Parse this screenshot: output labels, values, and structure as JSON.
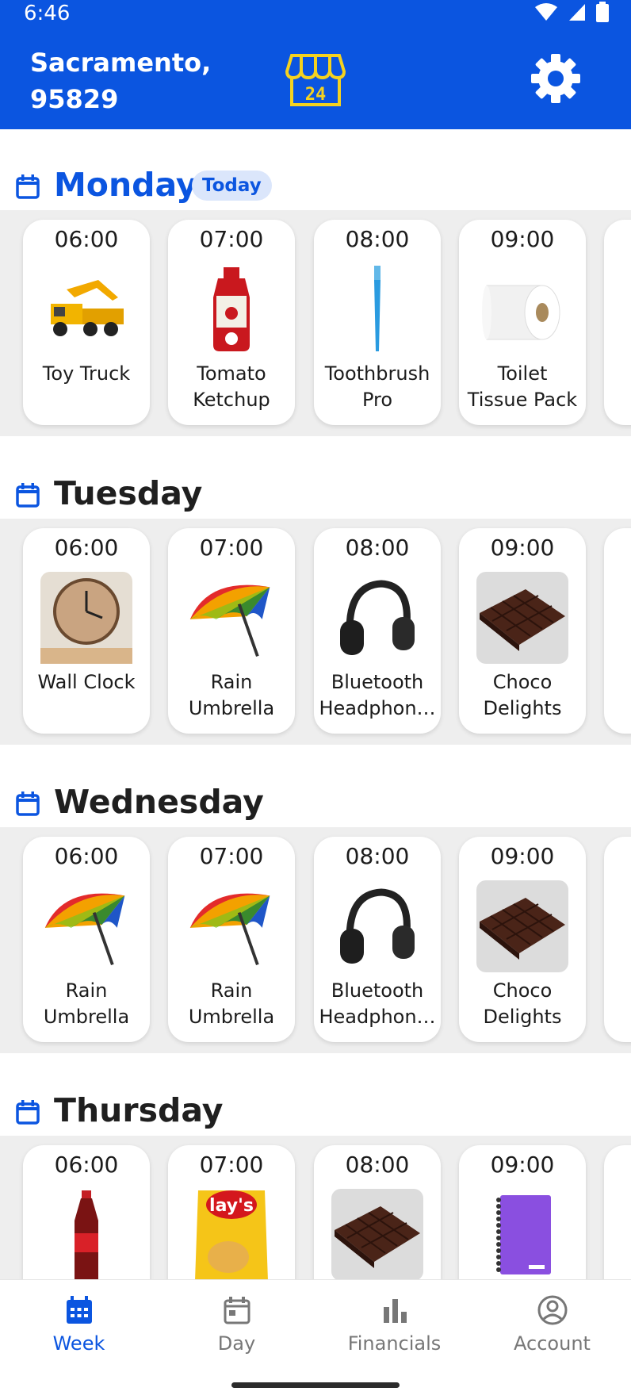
{
  "status": {
    "time": "6:46"
  },
  "header": {
    "location_line1": "Sacramento,",
    "location_line2": "95829",
    "store_icon": "store-24-icon",
    "settings_icon": "gear-icon",
    "brand_color": "#0b55e0",
    "accent_color": "#f5d21f"
  },
  "days": [
    {
      "name": "Monday",
      "badge": "Today",
      "items": [
        {
          "time": "06:00",
          "line1": "Toy Truck",
          "line2": "",
          "icon": "toy-truck-icon"
        },
        {
          "time": "07:00",
          "line1": "Tomato",
          "line2": "Ketchup",
          "icon": "ketchup-bottle-icon"
        },
        {
          "time": "08:00",
          "line1": "Toothbrush",
          "line2": "Pro",
          "icon": "toothbrush-icon"
        },
        {
          "time": "09:00",
          "line1": "Toilet",
          "line2": "Tissue Pack",
          "icon": "toilet-paper-icon"
        }
      ]
    },
    {
      "name": "Tuesday",
      "items": [
        {
          "time": "06:00",
          "line1": "Wall Clock",
          "line2": "",
          "icon": "wall-clock-icon"
        },
        {
          "time": "07:00",
          "line1": "Rain",
          "line2": "Umbrella",
          "icon": "umbrella-icon"
        },
        {
          "time": "08:00",
          "line1": "Bluetooth",
          "line2": "Headphon…",
          "icon": "headphones-icon"
        },
        {
          "time": "09:00",
          "line1": "Choco",
          "line2": "Delights",
          "icon": "chocolate-bar-icon"
        }
      ]
    },
    {
      "name": "Wednesday",
      "items": [
        {
          "time": "06:00",
          "line1": "Rain",
          "line2": "Umbrella",
          "icon": "umbrella-icon"
        },
        {
          "time": "07:00",
          "line1": "Rain",
          "line2": "Umbrella",
          "icon": "umbrella-icon"
        },
        {
          "time": "08:00",
          "line1": "Bluetooth",
          "line2": "Headphon…",
          "icon": "headphones-icon"
        },
        {
          "time": "09:00",
          "line1": "Choco",
          "line2": "Delights",
          "icon": "chocolate-bar-icon"
        }
      ]
    },
    {
      "name": "Thursday",
      "items": [
        {
          "time": "06:00",
          "line1": "",
          "line2": "",
          "icon": "cola-bottle-icon"
        },
        {
          "time": "07:00",
          "line1": "",
          "line2": "",
          "icon": "chips-bag-icon"
        },
        {
          "time": "08:00",
          "line1": "",
          "line2": "",
          "icon": "chocolate-bar-icon"
        },
        {
          "time": "09:00",
          "line1": "",
          "line2": "",
          "icon": "notebook-icon"
        }
      ]
    }
  ],
  "nav": {
    "week": "Week",
    "day": "Day",
    "financials": "Financials",
    "account": "Account",
    "active": "Week"
  }
}
